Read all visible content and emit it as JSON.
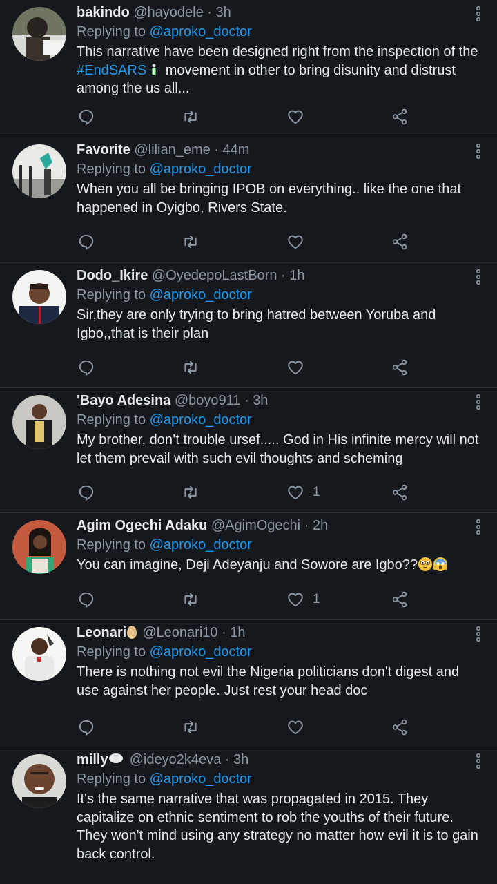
{
  "tweets": [
    {
      "name": "bakindo",
      "handle": "@hayodele",
      "time": "3h",
      "replying_prefix": "Replying to ",
      "replying_to": "@aproko_doctor",
      "text_parts": [
        "This narrative have been designed right from the inspection of the ",
        "#EndSARS",
        " movement in other to bring disunity and distrust among the us all..."
      ],
      "likes": ""
    },
    {
      "name": "Favorite",
      "handle": "@lilian_eme",
      "time": "44m",
      "replying_prefix": "Replying to ",
      "replying_to": "@aproko_doctor",
      "text": "When you all be bringing IPOB on everything.. like the one that happened in Oyigbo, Rivers State.",
      "likes": ""
    },
    {
      "name": "Dodo_Ikire",
      "handle": "@OyedepoLastBorn",
      "time": "1h",
      "replying_prefix": "Replying to ",
      "replying_to": "@aproko_doctor",
      "text": "Sir,they are only trying to bring hatred between Yoruba and Igbo,,that is their plan",
      "likes": ""
    },
    {
      "name": "'Bayo Adesina",
      "handle": "@boyo911",
      "time": "3h",
      "replying_prefix": "Replying to ",
      "replying_to": "@aproko_doctor",
      "text": "My brother, don’t trouble ursef..... God in His infinite mercy will not let them prevail with such evil thoughts and scheming",
      "likes": "1"
    },
    {
      "name": "Agim Ogechi Adaku",
      "handle": "@AgimOgechi",
      "time": "2h",
      "replying_prefix": "Replying to ",
      "replying_to": "@aproko_doctor",
      "text": "You can imagine, Deji Adeyanju and Sowore are Igbo??",
      "likes": "1"
    },
    {
      "name": "Leonari",
      "handle": "@Leonari10",
      "time": "1h",
      "replying_prefix": "Replying to ",
      "replying_to": "@aproko_doctor",
      "text": "There is nothing not evil the Nigeria politicians don't digest and use against her people. Just rest your head doc",
      "likes": ""
    },
    {
      "name": "milly",
      "handle": "@ideyo2k4eva",
      "time": "3h",
      "replying_prefix": "Replying to ",
      "replying_to": "@aproko_doctor",
      "text": "It's the same narrative that was propagated in 2015. They capitalize on ethnic sentiment to rob the youths of their future. They won't mind using any strategy no matter how evil it is to gain back control.",
      "likes": ""
    }
  ],
  "separator": " · ",
  "icons": {
    "reply": "reply-icon",
    "retweet": "retweet-icon",
    "like": "like-icon",
    "share": "share-icon",
    "more": "more-options-icon"
  },
  "colors": {
    "background": "#15181c",
    "text": "#e7e9ea",
    "muted": "#8b98a5",
    "link": "#1d9bf0",
    "divider": "#2f3336"
  }
}
